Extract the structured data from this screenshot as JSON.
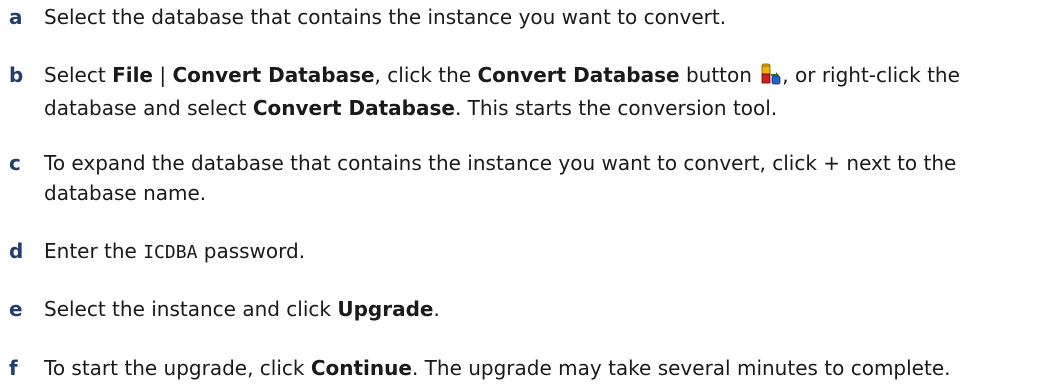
{
  "steps": [
    {
      "letter": "a",
      "text": "Select the database that contains the instance you want to convert."
    },
    {
      "letter": "b",
      "t1": "Select ",
      "b1": "File",
      "t2": " | ",
      "b2": "Convert Database",
      "t3": ", click the ",
      "b3": "Convert Database",
      "t4": " button ",
      "icon": "convert-database-icon",
      "t5": ", or right-click the database and select ",
      "b4": "Convert Database",
      "t6": ". This starts the conversion tool."
    },
    {
      "letter": "c",
      "text": "To expand the database that contains the instance you want to convert, click + next to the database name."
    },
    {
      "letter": "d",
      "t1": "Enter the ",
      "mono": "ICDBA",
      "t2": " password."
    },
    {
      "letter": "e",
      "t1": "Select the instance and click ",
      "b1": "Upgrade",
      "t2": "."
    },
    {
      "letter": "f",
      "t1": "To start the upgrade, click ",
      "b1": "Continue",
      "t2": ". The upgrade may take several minutes to complete."
    }
  ],
  "colors": {
    "letter": "#1f3f73",
    "text": "#1a1a1a"
  }
}
